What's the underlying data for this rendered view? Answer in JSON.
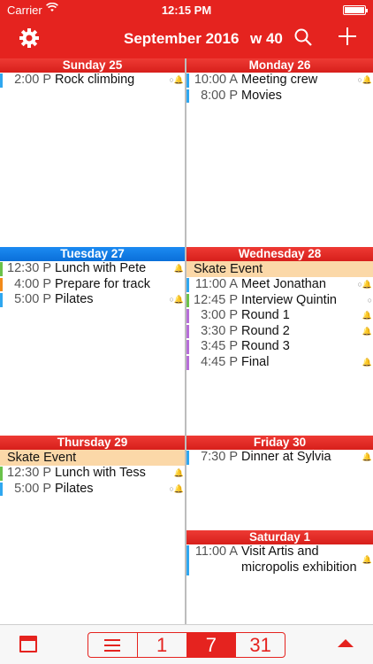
{
  "status_bar": {
    "carrier": "Carrier",
    "time": "12:15 PM"
  },
  "nav": {
    "title": "September 2016",
    "week": "w 40"
  },
  "days": {
    "sunday": {
      "header": "Sunday 25",
      "events": [
        {
          "time": "2:00 P",
          "title": "Rock climbing",
          "color": "#2fa7f0",
          "indicators": "○🔔"
        }
      ]
    },
    "monday": {
      "header": "Monday 26",
      "events": [
        {
          "time": "10:00 A",
          "title": "Meeting crew",
          "color": "#2fa7f0",
          "indicators": "○🔔"
        },
        {
          "time": "8:00 P",
          "title": "Movies",
          "color": "#2fa7f0",
          "indicators": ""
        }
      ]
    },
    "tuesday": {
      "header": "Tuesday 27",
      "events": [
        {
          "time": "12:30 P",
          "title": "Lunch with Pete",
          "color": "#6ac24a",
          "indicators": "🔔"
        },
        {
          "time": "4:00 P",
          "title": "Prepare for track",
          "color": "#f28a1a",
          "indicators": ""
        },
        {
          "time": "5:00 P",
          "title": "Pilates",
          "color": "#2fa7f0",
          "indicators": "○🔔"
        }
      ]
    },
    "wednesday": {
      "header": "Wednesday 28",
      "allday": "Skate Event",
      "events": [
        {
          "time": "11:00 A",
          "title": "Meet Jonathan",
          "color": "#2fa7f0",
          "indicators": "○🔔"
        },
        {
          "time": "12:45 P",
          "title": "Interview Quintin",
          "color": "#6ac24a",
          "indicators": "○"
        },
        {
          "time": "3:00 P",
          "title": "Round 1",
          "color": "#b66ed8",
          "indicators": "🔔"
        },
        {
          "time": "3:30 P",
          "title": "Round 2",
          "color": "#b66ed8",
          "indicators": "🔔"
        },
        {
          "time": "3:45 P",
          "title": "Round 3",
          "color": "#b66ed8",
          "indicators": ""
        },
        {
          "time": "4:45 P",
          "title": "Final",
          "color": "#b66ed8",
          "indicators": "🔔"
        }
      ]
    },
    "thursday": {
      "header": "Thursday 29",
      "allday": "Skate Event",
      "events": [
        {
          "time": "12:30 P",
          "title": "Lunch with Tess",
          "color": "#6ac24a",
          "indicators": "🔔"
        },
        {
          "time": "5:00 P",
          "title": "Pilates",
          "color": "#2fa7f0",
          "indicators": "○🔔"
        }
      ]
    },
    "friday": {
      "header": "Friday 30",
      "events": [
        {
          "time": "7:30 P",
          "title": "Dinner at Sylvia",
          "color": "#2fa7f0",
          "indicators": "🔔"
        }
      ]
    },
    "saturday": {
      "header": "Saturday 1",
      "events": [
        {
          "time": "11:00 A",
          "title": "Visit Artis and micropolis exhibition",
          "color": "#2fa7f0",
          "indicators": "🔔"
        }
      ]
    }
  },
  "toolbar": {
    "day_label": "1",
    "week_label": "7",
    "month_label": "31"
  },
  "colors": {
    "accent": "#e5231f",
    "today": "#1c8bf2",
    "allday_bg": "#fbd8a8"
  }
}
